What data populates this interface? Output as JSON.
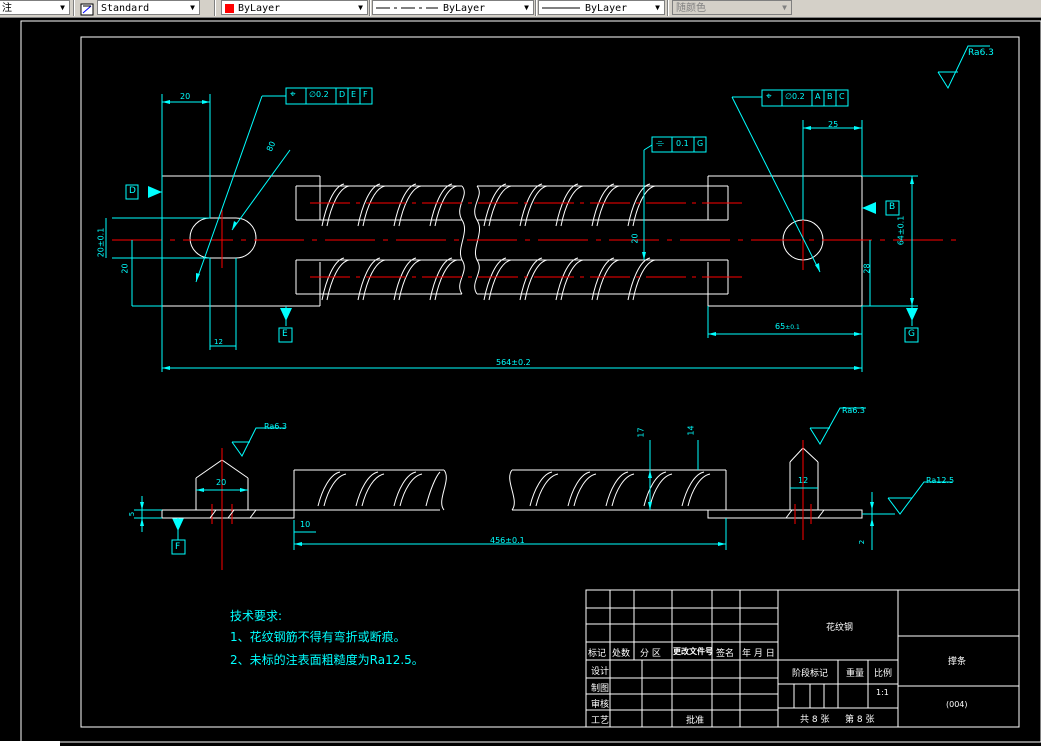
{
  "toolbar": {
    "text_style_label": "注",
    "dim_style": "Standard",
    "color": "ByLayer",
    "color_swatch": "#ff0000",
    "linetype": "ByLayer",
    "lineweight": "ByLayer",
    "plot_style": "随颜色"
  },
  "drawing": {
    "top_view": {
      "dim_20_top": "20",
      "dim_80": "80",
      "dim_25": "25",
      "dim_phi": "20",
      "dim_d12": "12",
      "dim_20_width": "20",
      "dim_20h": "20",
      "dim_20_left": "20",
      "dim_28": "28",
      "dim_right_vert": "64±0.1",
      "dim_65": "65",
      "dim_65_tol": "±0.1",
      "dim_564": "564±0.2",
      "dim_20_center": "20",
      "dim_left_vert": "20±0.1",
      "datum_d": "D",
      "datum_b": "B",
      "datum_e": "E",
      "datum_g": "G",
      "fcf_left": [
        "⌖",
        "∅0.2",
        "D",
        "E",
        "F"
      ],
      "fcf_right": [
        "⌖",
        "∅0.2",
        "A",
        "B",
        "C"
      ],
      "fcf_mid": [
        "⌯",
        "0.1",
        "G"
      ],
      "rough_corner": "Ra6.3"
    },
    "front_view": {
      "rough_left": "Ra6.3",
      "rough_right_top": "Ra6.3",
      "rough_right": "Ra12.5",
      "dim_20_end": "20",
      "dim_12_end": "12",
      "dim_10": "10",
      "dim_456": "456±0.1",
      "dim_17": "17",
      "dim_14": "14",
      "dim_5": "5",
      "dim_2": "2",
      "datum_f": "F"
    },
    "notes": {
      "title": "技术要求:",
      "line1": "1、花纹钢筋不得有弯折或断痕。",
      "line2": "2、未标的注表面粗糙度为Ra12.5。"
    },
    "title_block": {
      "part_name": "花纹钢",
      "drawing_name": "撑条",
      "drawing_no": "(004)",
      "header_cells": [
        "标记",
        "处数",
        "分 区",
        "更改文件号",
        "签名",
        "年 月 日"
      ],
      "roles": [
        "设计",
        "制图",
        "审核",
        "工艺"
      ],
      "approve": "批准",
      "stage_mark": "阶段标记",
      "weight": "重量",
      "scale": "比例",
      "scale_value": "1:1",
      "sheets_total": "共 8 张",
      "sheet_no": "第 8 张"
    }
  }
}
